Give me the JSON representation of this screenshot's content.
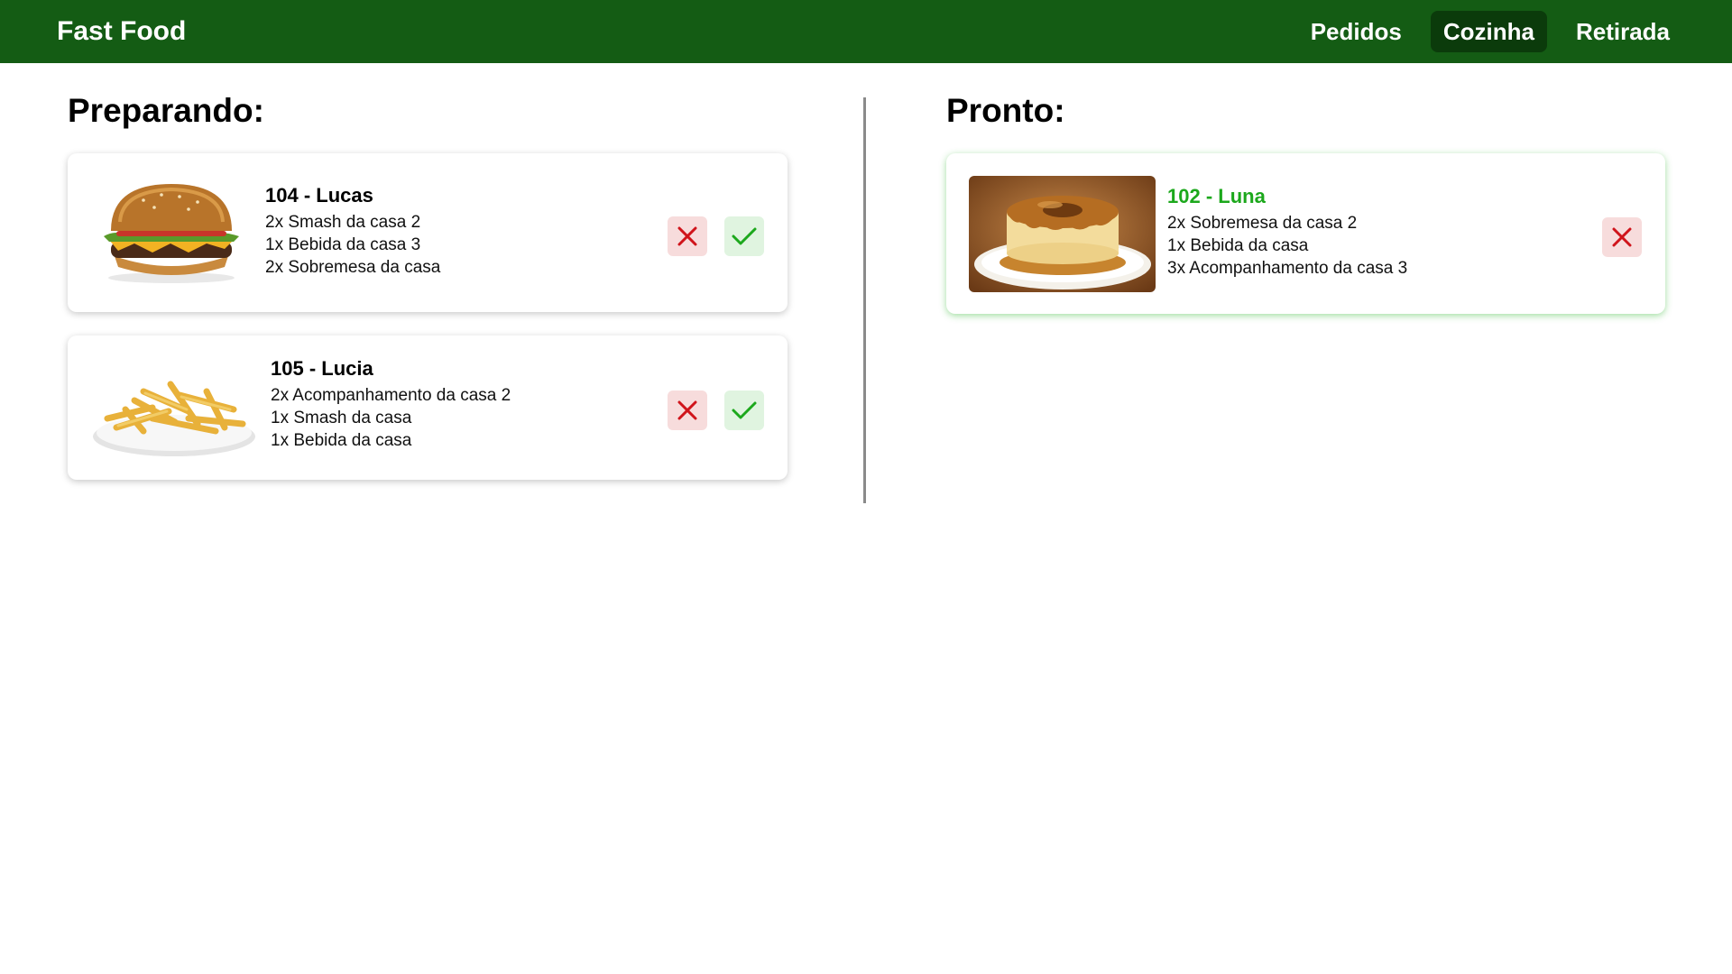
{
  "app": {
    "brand": "Fast Food"
  },
  "nav": {
    "items": [
      {
        "label": "Pedidos"
      },
      {
        "label": "Cozinha",
        "active": true
      },
      {
        "label": "Retirada"
      }
    ]
  },
  "columns": {
    "preparing": {
      "title": "Preparando:",
      "orders": [
        {
          "title": "104 - Lucas",
          "image": "burger-image",
          "items": [
            "2x Smash da casa 2",
            "1x Bebida da casa 3",
            "2x Sobremesa da casa"
          ]
        },
        {
          "title": "105 - Lucia",
          "image": "fries-image",
          "items": [
            "2x Acompanhamento da casa 2",
            "1x Smash da casa",
            "1x Bebida da casa"
          ]
        }
      ]
    },
    "ready": {
      "title": "Pronto:",
      "orders": [
        {
          "title": "102 - Luna",
          "image": "flan-image",
          "items": [
            "2x Sobremesa da casa 2",
            "1x Bebida da casa",
            "3x Acompanhamento da casa 3"
          ]
        }
      ]
    }
  },
  "colors": {
    "header": "#145c14",
    "active_tab": "#0b3b0b",
    "ready_title": "#1ca81c",
    "cancel": "#d0141b",
    "confirm": "#1ca81c"
  },
  "icons": {
    "cancel": "close-icon",
    "confirm": "check-icon"
  }
}
